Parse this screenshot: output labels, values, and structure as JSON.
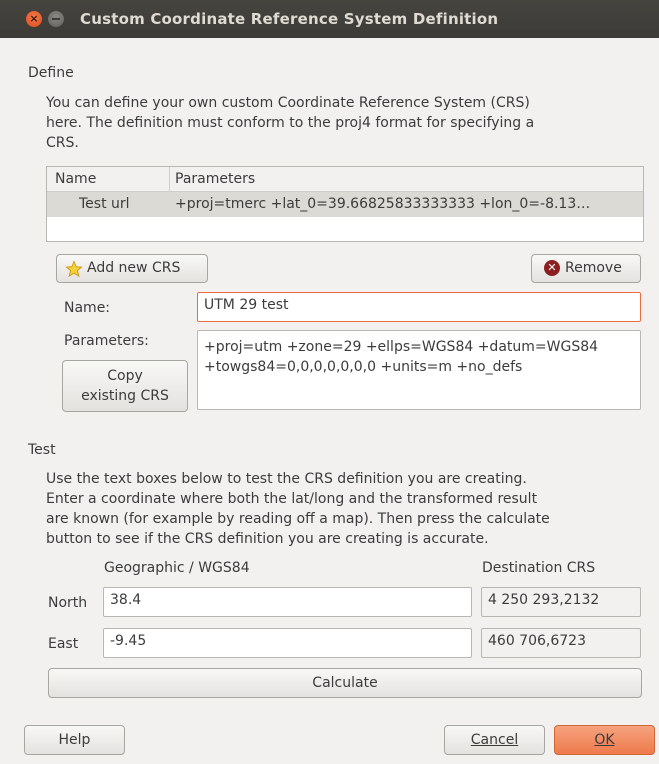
{
  "window": {
    "title": "Custom Coordinate Reference System Definition"
  },
  "define": {
    "heading": "Define",
    "description_lines": [
      "You can define your own custom Coordinate Reference System (CRS)",
      "here. The definition must conform to the proj4 format for specifying a",
      "CRS."
    ],
    "table": {
      "headers": [
        "Name",
        "Parameters"
      ],
      "rows": [
        {
          "name": "Test url",
          "parameters": "+proj=tmerc +lat_0=39.66825833333333 +lon_0=-8.13…"
        }
      ]
    },
    "add_button": "Add new CRS",
    "remove_button": "Remove",
    "name_label": "Name:",
    "name_value": "UTM 29 test",
    "parameters_label": "Parameters:",
    "parameters_lines": [
      "+proj=utm +zone=29 +ellps=WGS84 +datum=WGS84",
      "+towgs84=0,0,0,0,0,0,0 +units=m +no_defs"
    ],
    "copy_button_lines": [
      "Copy",
      "existing CRS"
    ]
  },
  "test": {
    "heading": "Test",
    "description_lines": [
      "Use the text boxes below to test the CRS definition you are creating.",
      "Enter a coordinate where both the lat/long and the transformed result",
      "are known (for example by reading off a map). Then press the calculate",
      "button to see if the CRS definition you are creating is accurate."
    ],
    "geographic_label": "Geographic / WGS84",
    "destination_label": "Destination CRS",
    "north_label": "North",
    "north_value": "38.4",
    "north_result": "4 250 293,2132",
    "east_label": "East",
    "east_value": "-9.45",
    "east_result": "460 706,6723",
    "calculate_button": "Calculate"
  },
  "footer": {
    "help": "Help",
    "cancel": "Cancel",
    "ok": "OK"
  },
  "icons": {
    "close": "close-icon",
    "minimize": "minimize-icon",
    "add": "star-icon",
    "remove": "remove-icon"
  },
  "colors": {
    "accent": "#e66e3f",
    "titlebar": "#3c3b37",
    "ok_button": "#ee7a4c"
  }
}
